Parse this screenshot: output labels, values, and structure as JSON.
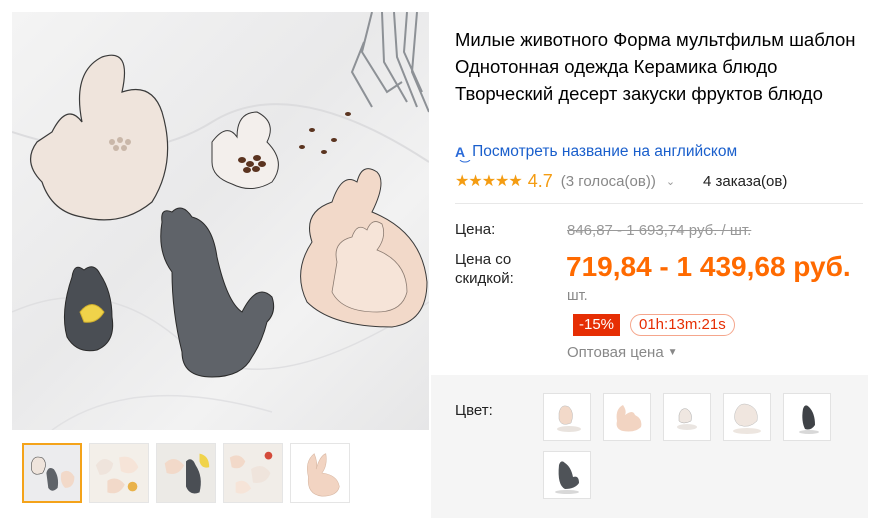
{
  "product": {
    "title": "Милые животного Форма мультфильм шаблон Однотонная одежда Керамика блюдо Творческий десерт закуски фруктов блюдо",
    "translate_icon": "A͜",
    "translate_link": "Посмотреть название на английском"
  },
  "rating": {
    "stars": "★★★★★",
    "value": "4.7",
    "votes": "(3 голоса(ов))",
    "chevron": "⌄",
    "orders": "4 заказа(ов)"
  },
  "price": {
    "label": "Цена:",
    "old": "846,87 - 1 693,74 руб. / шт.",
    "discount_label": "Цена со скидкой:",
    "discount": "719,84 - 1 439,68 руб.",
    "unit": "шт.",
    "badge": "-15%",
    "timer": "01h:13m:21s",
    "wholesale": "Оптовая цена",
    "wholesale_caret": "▼"
  },
  "color": {
    "label": "Цвет:",
    "swatches": [
      "squirrel-pink",
      "rabbit-pink",
      "squirrel-small",
      "squirrel-white",
      "cat-black",
      "cat-grey"
    ]
  },
  "gallery": {
    "thumbnails": [
      "thumb-1",
      "thumb-2",
      "thumb-3",
      "thumb-4",
      "thumb-5"
    ],
    "active_index": 0
  },
  "colors": {
    "accent_orange": "#ff6a00",
    "star_orange": "#f49c12",
    "link_blue": "#1a5fcc",
    "badge_red": "#e62e04",
    "active_thumb_border": "#f4a31a"
  }
}
